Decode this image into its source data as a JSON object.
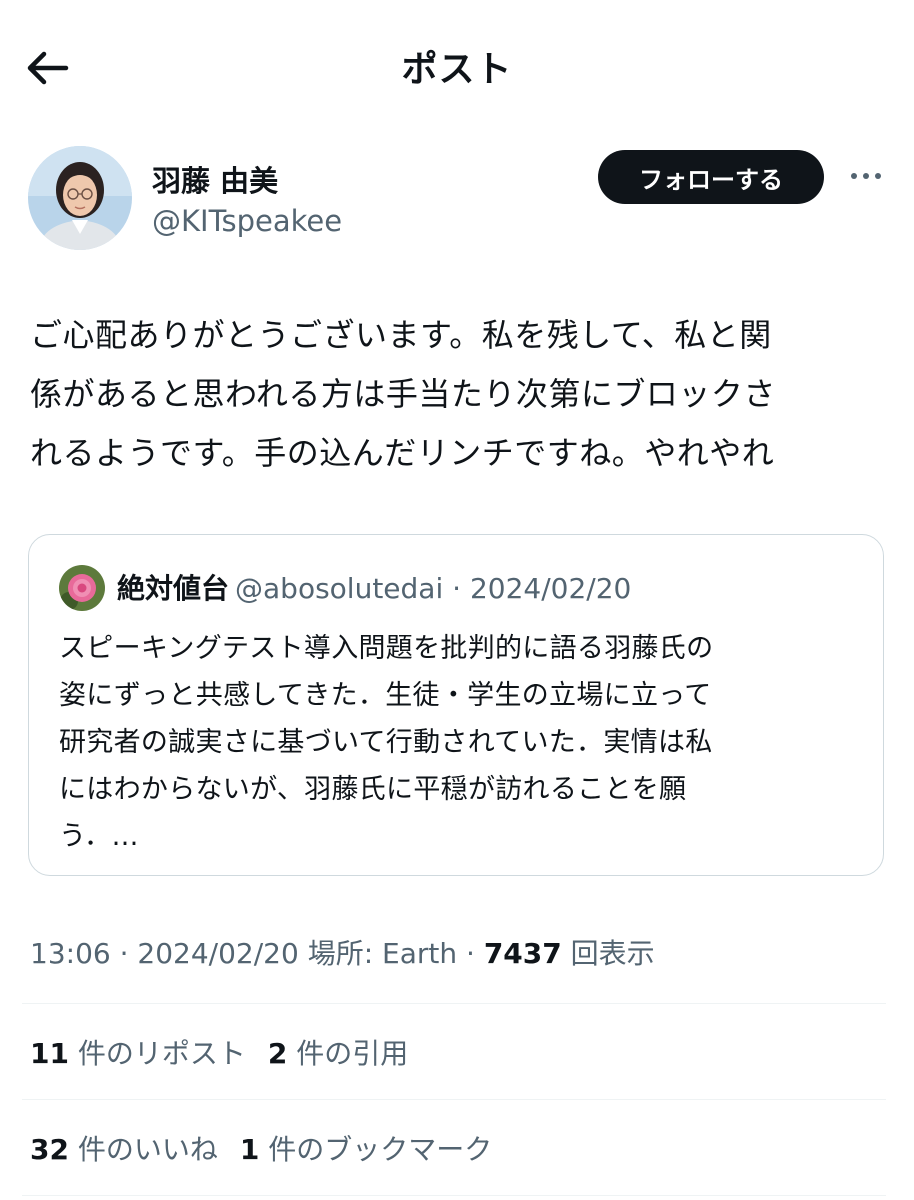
{
  "header": {
    "title": "ポスト"
  },
  "author": {
    "display_name": "羽藤 由美",
    "handle": "@KITspeakee",
    "follow_label": "フォローする"
  },
  "post": {
    "text": "ご心配ありがとうございます。私を残して、私と関\n係があると思われる方は手当たり次第にブロックさ\nれるようです。手の込んだリンチですね。やれやれ"
  },
  "quoted": {
    "name": "絶対値台",
    "handle": "@abosolutedai",
    "date": "2024/02/20",
    "text": "スピーキングテスト導入問題を批判的に語る羽藤氏の\n姿にずっと共感してきた．生徒・学生の立場に立って\n研究者の誠実さに基づいて行動されていた．実情は私\nにはわからないが、羽藤氏に平穏が訪れることを願\nう．…"
  },
  "meta": {
    "time": "13:06",
    "date": "2024/02/20",
    "location_label": "場所: Earth",
    "views_count": "7437",
    "views_label": "回表示"
  },
  "stats": {
    "reposts_count": "11",
    "reposts_label": "件のリポスト",
    "quotes_count": "2",
    "quotes_label": "件の引用",
    "likes_count": "32",
    "likes_label": "件のいいね",
    "bookmarks_count": "1",
    "bookmarks_label": "件のブックマーク"
  },
  "colors": {
    "text": "#0f1419",
    "secondary": "#536471",
    "border": "#cfd9de",
    "follow_bg": "#0f1419"
  }
}
